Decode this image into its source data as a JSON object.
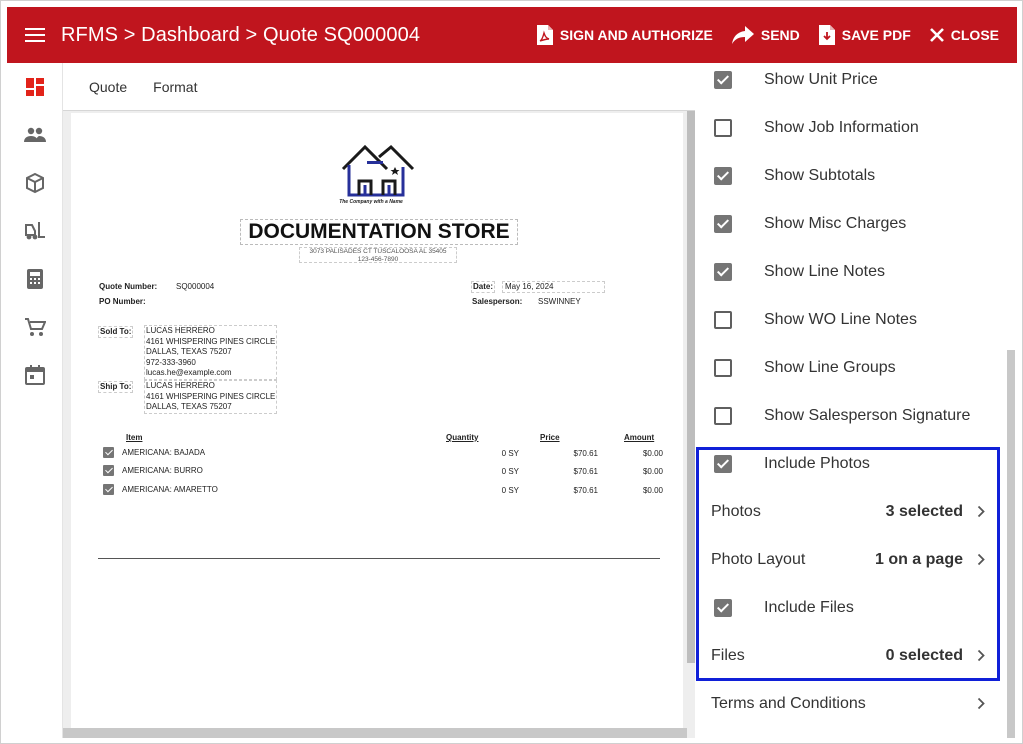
{
  "header": {
    "breadcrumb": "RFMS > Dashboard > Quote SQ000004",
    "actions": {
      "sign": "SIGN AND AUTHORIZE",
      "send": "SEND",
      "save_pdf": "SAVE PDF",
      "close": "CLOSE"
    }
  },
  "sidebar": {
    "icons": [
      "dashboard-icon",
      "people-icon",
      "package-icon",
      "forklift-icon",
      "calculator-icon",
      "cart-icon",
      "calendar-icon"
    ],
    "active_color": "#e2231a"
  },
  "tabs": [
    "Quote",
    "Format"
  ],
  "document": {
    "logo_caption": "The Company with a Name",
    "store_name": "DOCUMENTATION STORE",
    "address": "3073 PALISADES CT TUSCALOOSA AL 35405",
    "phone": "123-456-7890",
    "quote_number_label": "Quote Number:",
    "quote_number": "SQ000004",
    "po_number_label": "PO Number:",
    "date_label": "Date:",
    "date": "May 16, 2024",
    "salesperson_label": "Salesperson:",
    "salesperson": "SSWINNEY",
    "sold_to_label": "Sold To:",
    "sold_to": [
      "LUCAS HERRERO",
      "4161 WHISPERING PINES CIRCLE",
      "DALLAS, TEXAS 75207",
      "972-333-3960",
      "lucas.he@example.com"
    ],
    "ship_to_label": "Ship To:",
    "ship_to": [
      "LUCAS HERRERO",
      "4161 WHISPERING PINES CIRCLE",
      "DALLAS, TEXAS 75207"
    ],
    "columns": {
      "item": "Item",
      "quantity": "Quantity",
      "price": "Price",
      "amount": "Amount"
    },
    "items": [
      {
        "name": "AMERICANA: BAJADA",
        "qty": "0 SY",
        "price": "$70.61",
        "amount": "$0.00"
      },
      {
        "name": "AMERICANA: BURRO",
        "qty": "0 SY",
        "price": "$70.61",
        "amount": "$0.00"
      },
      {
        "name": "AMERICANA: AMARETTO",
        "qty": "0 SY",
        "price": "$70.61",
        "amount": "$0.00"
      }
    ]
  },
  "options": {
    "show_unit_price": {
      "label": "Show Unit Price",
      "checked": true
    },
    "show_job_information": {
      "label": "Show Job Information",
      "checked": false
    },
    "show_subtotals": {
      "label": "Show Subtotals",
      "checked": true
    },
    "show_misc_charges": {
      "label": "Show Misc Charges",
      "checked": true
    },
    "show_line_notes": {
      "label": "Show Line Notes",
      "checked": true
    },
    "show_wo_line_notes": {
      "label": "Show WO Line Notes",
      "checked": false
    },
    "show_line_groups": {
      "label": "Show Line Groups",
      "checked": false
    },
    "show_salesperson_signature": {
      "label": "Show Salesperson Signature",
      "checked": false
    },
    "include_photos": {
      "label": "Include Photos",
      "checked": true
    },
    "photos": {
      "label": "Photos",
      "value": "3 selected"
    },
    "photo_layout": {
      "label": "Photo Layout",
      "value": "1 on a page"
    },
    "include_files": {
      "label": "Include Files",
      "checked": true
    },
    "files": {
      "label": "Files",
      "value": "0 selected"
    },
    "terms": {
      "label": "Terms and Conditions"
    }
  },
  "colors": {
    "brand_red": "#c0151e",
    "highlight_blue": "#1020d8",
    "checkbox_gray": "#757575"
  }
}
